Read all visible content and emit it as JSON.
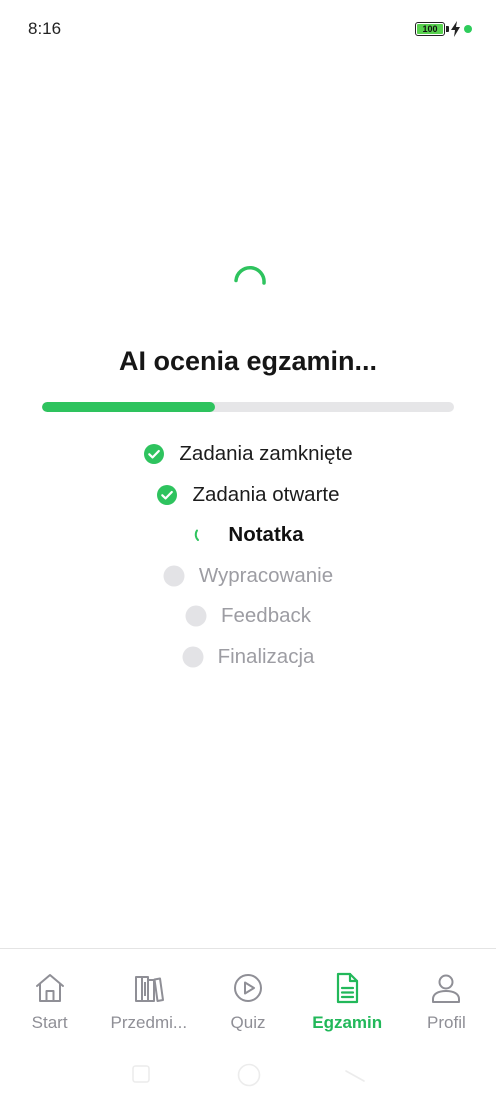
{
  "status_bar": {
    "time": "8:16",
    "battery_level": "100",
    "battery_color": "#58d14f",
    "charging_icon": "bolt-icon",
    "indicator_color": "#2ecc5b"
  },
  "main": {
    "spinner_icon": "loading-spinner-icon",
    "title": "AI ocenia egzamin...",
    "progress_fraction": 0.42,
    "accent_color": "#2ec35e",
    "steps": [
      {
        "label": "Zadania zamknięte",
        "state": "done"
      },
      {
        "label": "Zadania otwarte",
        "state": "done"
      },
      {
        "label": "Notatka",
        "state": "active"
      },
      {
        "label": "Wypracowanie",
        "state": "pending"
      },
      {
        "label": "Feedback",
        "state": "pending"
      },
      {
        "label": "Finalizacja",
        "state": "pending"
      }
    ]
  },
  "bottom_nav": {
    "items": [
      {
        "label": "Start",
        "icon": "home-icon",
        "active": false
      },
      {
        "label": "Przedmi...",
        "icon": "books-icon",
        "active": false
      },
      {
        "label": "Quiz",
        "icon": "play-circle-icon",
        "active": false
      },
      {
        "label": "Egzamin",
        "icon": "document-icon",
        "active": true
      },
      {
        "label": "Profil",
        "icon": "user-icon",
        "active": false
      }
    ],
    "active_color": "#22b85a",
    "inactive_color": "#8f8f96"
  },
  "system_nav": {
    "icons": [
      "recent-apps-icon",
      "home-circle-icon",
      "back-icon"
    ]
  }
}
